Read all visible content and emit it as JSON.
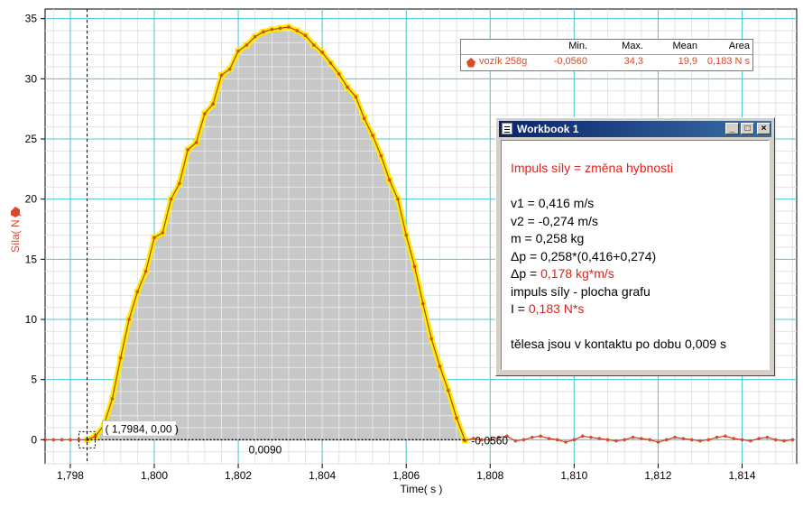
{
  "chart_data": {
    "type": "area",
    "xlabel": "Time( s )",
    "ylabel": "Síla( N )",
    "xlim": [
      1.7974,
      1.8153
    ],
    "ylim": [
      -2.0,
      35.8
    ],
    "x_ticks": [
      1.798,
      1.8,
      1.802,
      1.804,
      1.806,
      1.808,
      1.81,
      1.812,
      1.814
    ],
    "x_tick_labels": [
      "1,798",
      "1,800",
      "1,802",
      "1,804",
      "1,806",
      "1,808",
      "1,810",
      "1,812",
      "1,814"
    ],
    "y_ticks": [
      0,
      5,
      10,
      15,
      20,
      25,
      30,
      35
    ],
    "y_tick_labels": [
      "0",
      "5",
      "10",
      "15",
      "20",
      "25",
      "30",
      "35"
    ],
    "grid": true,
    "series": [
      {
        "name": "vozík 258g",
        "color": "#d84a2a",
        "highlight_color": "#f5f000",
        "highlight_range": [
          1.7984,
          1.8074
        ],
        "x": [
          1.7974,
          1.7976,
          1.7978,
          1.798,
          1.7982,
          1.7984,
          1.7986,
          1.7988,
          1.799,
          1.7992,
          1.7994,
          1.7996,
          1.7998,
          1.8,
          1.8002,
          1.8004,
          1.8006,
          1.8008,
          1.801,
          1.8012,
          1.8014,
          1.8016,
          1.8018,
          1.802,
          1.8022,
          1.8024,
          1.8026,
          1.8028,
          1.803,
          1.8032,
          1.8034,
          1.8036,
          1.8038,
          1.804,
          1.8042,
          1.8044,
          1.8046,
          1.8048,
          1.805,
          1.8052,
          1.8054,
          1.8056,
          1.8058,
          1.806,
          1.8062,
          1.8064,
          1.8066,
          1.8068,
          1.807,
          1.8072,
          1.8074,
          1.8076,
          1.8078,
          1.808,
          1.8082,
          1.8084,
          1.8086,
          1.8088,
          1.809,
          1.8092,
          1.8094,
          1.8096,
          1.8098,
          1.81,
          1.8102,
          1.8104,
          1.8106,
          1.8108,
          1.811,
          1.8112,
          1.8114,
          1.8116,
          1.8118,
          1.812,
          1.8122,
          1.8124,
          1.8126,
          1.8128,
          1.813,
          1.8132,
          1.8134,
          1.8136,
          1.8138,
          1.814,
          1.8142,
          1.8144,
          1.8146,
          1.8148,
          1.815,
          1.8152
        ],
        "values": [
          0.0,
          0.0,
          0.0,
          0.0,
          0.0,
          0.0,
          0.3,
          1.2,
          3.4,
          6.8,
          10.0,
          12.3,
          14.0,
          16.8,
          17.2,
          20.0,
          21.3,
          24.1,
          24.7,
          27.1,
          27.9,
          30.3,
          30.8,
          32.3,
          32.8,
          33.5,
          33.9,
          34.1,
          34.2,
          34.3,
          34.0,
          33.6,
          32.8,
          32.2,
          31.3,
          30.4,
          29.3,
          28.5,
          26.7,
          25.3,
          23.6,
          21.6,
          20.0,
          17.0,
          14.4,
          11.3,
          8.4,
          6.1,
          4.1,
          1.8,
          -0.056,
          0.1,
          0.0,
          0.0,
          0.2,
          0.3,
          -0.1,
          0.0,
          0.2,
          0.3,
          0.1,
          0.0,
          -0.2,
          0.0,
          0.3,
          0.2,
          0.1,
          0.0,
          -0.1,
          0.0,
          0.2,
          0.1,
          0.0,
          -0.2,
          0.0,
          0.2,
          0.1,
          0.0,
          -0.1,
          0.0,
          0.2,
          0.3,
          0.1,
          0.0,
          -0.1,
          0.1,
          0.2,
          0.0,
          -0.1,
          0.0
        ]
      }
    ],
    "annotations": {
      "cursor_x": 1.7984,
      "cursor_label": "( 1,7984, 0,00 )",
      "interval_label": "0,0090",
      "end_label": "-0,0560"
    }
  },
  "stats": {
    "headers": [
      "Min.",
      "Max.",
      "Mean",
      "Area"
    ],
    "series_label": "vozík 258g",
    "min": "-0,0560",
    "max": "34,3",
    "mean": "19,9",
    "area": "0,183 N s"
  },
  "workbook": {
    "title": "Workbook 1",
    "buttons": [
      "_",
      "□",
      "×"
    ],
    "heading": "Impuls síly = změna hybnosti",
    "v1": "v1 = 0,416 m/s",
    "v2": "v2 = -0,274 m/s",
    "m": "m = 0,258 kg",
    "dp_formula": "Δp = 0,258*(0,416+0,274)",
    "dp_result_prefix": "Δp = ",
    "dp_result_value": "0,178 kg*m/s",
    "impulse_text": "impuls síly - plocha grafu",
    "I_prefix": "I = ",
    "I_value": "0,183 N*s",
    "contact": "tělesa jsou v kontaktu po dobu 0,009 s"
  }
}
